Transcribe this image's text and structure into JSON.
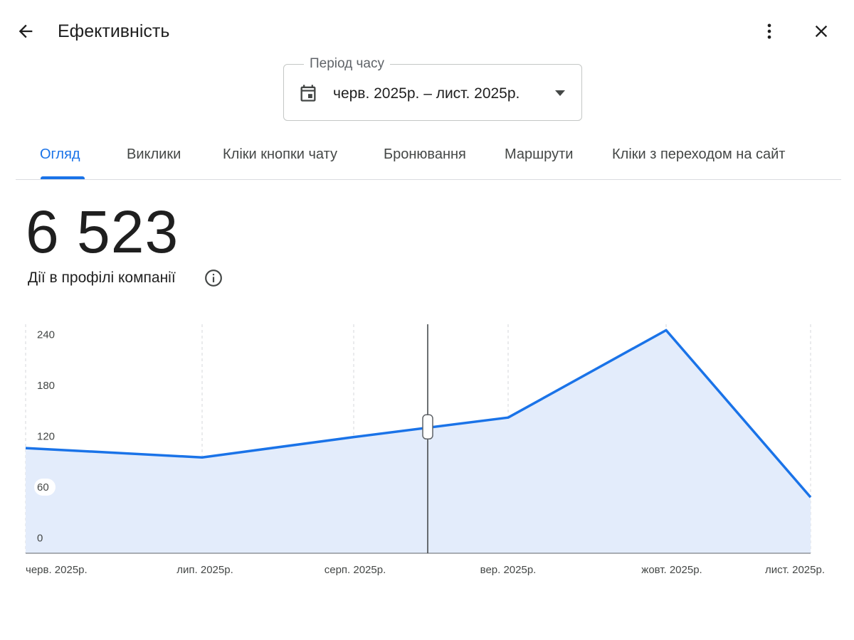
{
  "header": {
    "title": "Ефективність",
    "back_icon": "arrow-back-icon",
    "more_icon": "more-vert-icon",
    "close_icon": "close-icon"
  },
  "period": {
    "label": "Період часу",
    "value": "черв. 2025р. – лист. 2025р.",
    "icon": "calendar-icon",
    "dropdown_icon": "arrow-drop-down-icon"
  },
  "tabs": [
    {
      "label": "Огляд",
      "active": true
    },
    {
      "label": "Виклики",
      "active": false
    },
    {
      "label": "Кліки кнопки чату",
      "active": false
    },
    {
      "label": "Бронювання",
      "active": false
    },
    {
      "label": "Маршрути",
      "active": false
    },
    {
      "label": "Кліки з переходом на сайт",
      "active": false
    }
  ],
  "summary": {
    "total": "6 523",
    "label": "Дії в профілі компанії",
    "info_icon": "info-icon"
  },
  "colors": {
    "accent": "#1a73e8",
    "line": "#1a73e8",
    "area": "#e3ecfb",
    "text": "#1f1f1f",
    "muted": "#444746"
  },
  "chart_data": {
    "type": "area",
    "categories": [
      "черв. 2025р.",
      "лип. 2025р.",
      "серп. 2025р.",
      "вер. 2025р.",
      "жовт. 2025р.",
      "лист. 2025р."
    ],
    "x_positions": [
      0,
      1,
      2,
      3,
      4,
      5
    ],
    "series": [
      {
        "values": [
          106,
          95,
          119,
          142,
          245,
          48
        ]
      }
    ],
    "cursor_value": 131,
    "yticks": [
      0,
      60,
      120,
      180,
      240
    ],
    "ylim": [
      -18,
      252
    ],
    "grid": "vertical-dashed"
  }
}
